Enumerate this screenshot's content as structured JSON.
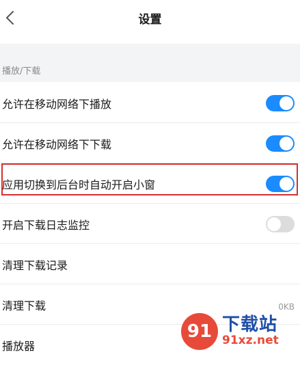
{
  "header": {
    "title": "设置"
  },
  "section": {
    "label": "播放/下载"
  },
  "rows": [
    {
      "label": "允许在移动网络下播放",
      "toggle": "on"
    },
    {
      "label": "允许在移动网络下下载",
      "toggle": "on"
    },
    {
      "label": "应用切换到后台时自动开启小窗",
      "toggle": "on"
    },
    {
      "label": "开启下载日志监控",
      "toggle": "off"
    },
    {
      "label": "清理下载记录"
    },
    {
      "label": "清理下载",
      "value": "0KB"
    },
    {
      "label": "播放器"
    }
  ],
  "watermark": {
    "badge": "91",
    "name": "下载站",
    "url": "91xz.net"
  },
  "colors": {
    "accent": "#1a8cff",
    "highlight": "#d32f2f",
    "toggle_off": "#dcdcdc"
  }
}
